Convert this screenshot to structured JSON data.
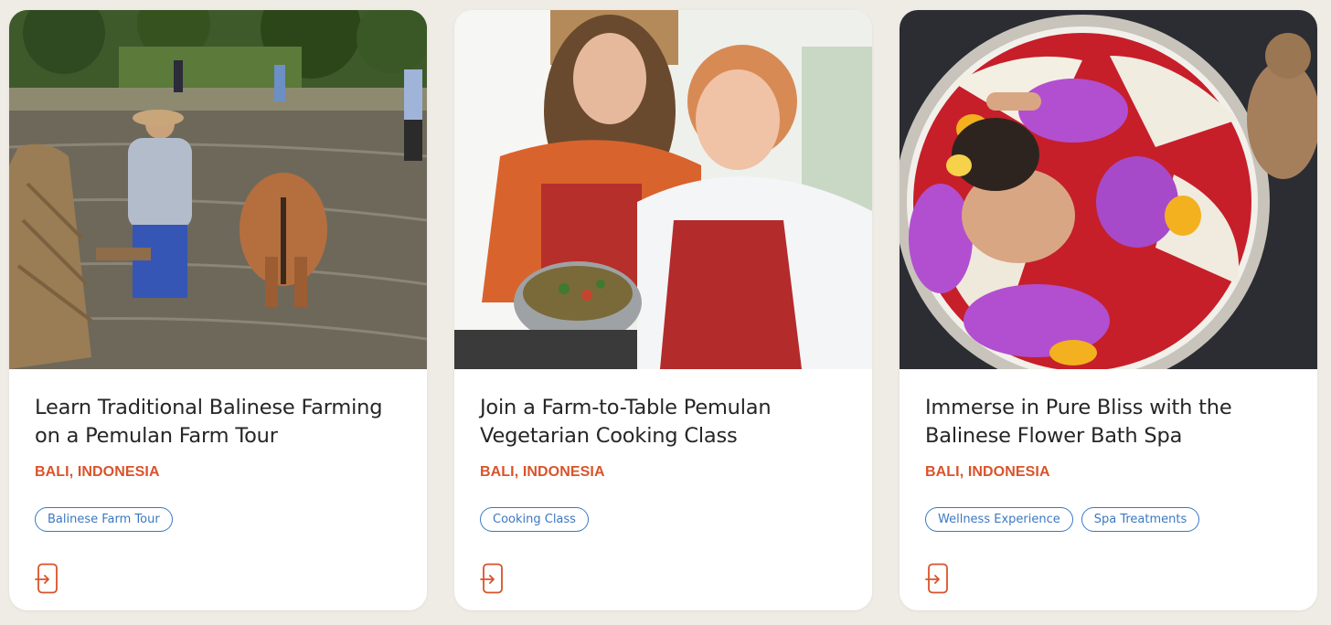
{
  "cards": [
    {
      "title": "Learn Traditional Balinese Farming on a Pemulan Farm Tour",
      "location": "BALI, INDONESIA",
      "tags": [
        "Balinese Farm Tour"
      ],
      "icon": "phone-booking-icon"
    },
    {
      "title": "Join a Farm-to-Table Pemulan Vegetarian Cooking Class",
      "location": "BALI, INDONESIA",
      "tags": [
        "Cooking Class"
      ],
      "icon": "phone-booking-icon"
    },
    {
      "title": "Immerse in Pure Bliss with the Balinese Flower Bath Spa",
      "location": "BALI, INDONESIA",
      "tags": [
        "Wellness Experience",
        "Spa Treatments"
      ],
      "icon": "phone-booking-icon"
    }
  ],
  "colors": {
    "background": "#efebe5",
    "location": "#d9532a",
    "tag": "#3b78c2",
    "title": "#262626"
  }
}
